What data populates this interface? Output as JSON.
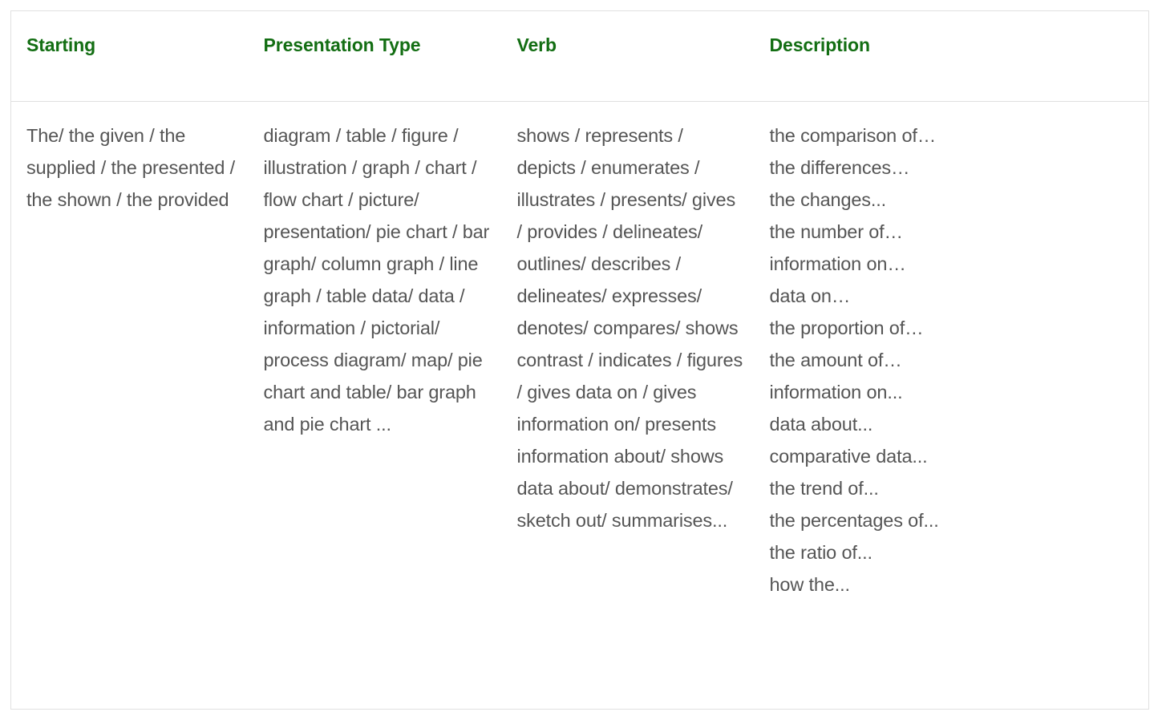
{
  "table": {
    "columns": [
      {
        "key": "starting",
        "header": "Starting"
      },
      {
        "key": "presentation",
        "header": "Presentation Type"
      },
      {
        "key": "verb",
        "header": "Verb"
      },
      {
        "key": "description",
        "header": "Description"
      }
    ],
    "rows": [
      {
        "starting": "The/ the given / the supplied / the presented / the shown / the provided",
        "presentation": "diagram / table / figure / illustration / graph / chart / flow chart / picture/ presentation/ pie chart / bar graph/ column graph / line graph / table data/ data / information / pictorial/ process diagram/ map/ pie chart and table/ bar graph and pie chart ...",
        "verb": "shows / represents / depicts / enumerates / illustrates / presents/ gives / provides / delineates/ outlines/ describes / delineates/ expresses/ denotes/ compares/ shows contrast / indicates / figures / gives data on / gives information on/ presents information about/ shows data about/ demonstrates/ sketch out/ summarises...",
        "description": "the comparison of…\nthe differences…\nthe changes...\nthe number of…\ninformation on…\ndata on…\nthe proportion of…\nthe amount of…\ninformation on...\ndata about...\ncomparative data...\nthe trend of...\nthe percentages of...\nthe ratio of...\nhow the..."
      }
    ],
    "colors": {
      "header_text": "#136e13",
      "body_text": "#555555",
      "border": "#e0e0e0",
      "background": "#ffffff"
    }
  }
}
